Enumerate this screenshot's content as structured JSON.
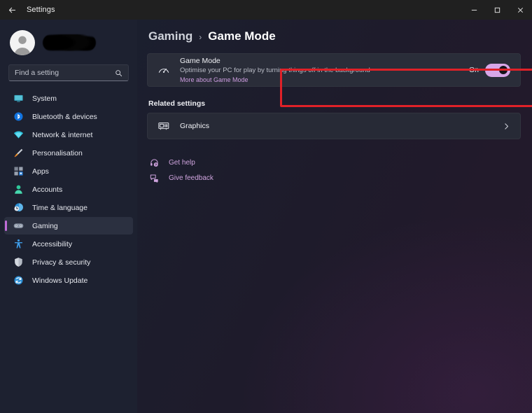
{
  "window": {
    "title": "Settings",
    "back_icon": "back-arrow-icon",
    "minimize_label": "Minimise",
    "maximize_label": "Maximise",
    "close_label": "Close"
  },
  "sidebar": {
    "account_name_redacted": true,
    "avatar_icon": "user-avatar-icon",
    "search": {
      "placeholder": "Find a setting",
      "value": "",
      "icon": "search-icon"
    },
    "items": [
      {
        "label": "System",
        "icon": "monitor-icon",
        "selected": false
      },
      {
        "label": "Bluetooth & devices",
        "icon": "bluetooth-icon",
        "selected": false
      },
      {
        "label": "Network & internet",
        "icon": "wifi-icon",
        "selected": false
      },
      {
        "label": "Personalisation",
        "icon": "paintbrush-icon",
        "selected": false
      },
      {
        "label": "Apps",
        "icon": "apps-grid-icon",
        "selected": false
      },
      {
        "label": "Accounts",
        "icon": "person-icon",
        "selected": false
      },
      {
        "label": "Time & language",
        "icon": "clock-globe-icon",
        "selected": false
      },
      {
        "label": "Gaming",
        "icon": "gamepad-icon",
        "selected": true
      },
      {
        "label": "Accessibility",
        "icon": "accessibility-icon",
        "selected": false
      },
      {
        "label": "Privacy & security",
        "icon": "shield-icon",
        "selected": false
      },
      {
        "label": "Windows Update",
        "icon": "update-refresh-icon",
        "selected": false
      }
    ]
  },
  "breadcrumb": {
    "parent": "Gaming",
    "separator": "›",
    "current": "Game Mode"
  },
  "game_mode_card": {
    "icon": "speedometer-icon",
    "title": "Game Mode",
    "description": "Optimise your PC for play by turning things off in the background",
    "more_link": "More about Game Mode",
    "toggle_state_label": "On",
    "toggle_on": true,
    "highlighted": true,
    "highlight_color": "#e02128",
    "toggle_accent": "#d7a6e8"
  },
  "related": {
    "section_title": "Related settings",
    "rows": [
      {
        "label": "Graphics",
        "icon": "graphics-card-icon",
        "chevron": "chevron-right-icon"
      }
    ]
  },
  "footer_links": [
    {
      "label": "Get help",
      "icon": "help-headset-icon"
    },
    {
      "label": "Give feedback",
      "icon": "feedback-icon"
    }
  ],
  "colors": {
    "accent": "#c06cd8",
    "link": "#cfa4de",
    "annotation": "#e02128",
    "sidebar_bg": "#1d2130",
    "card_bg": "#272a36"
  }
}
